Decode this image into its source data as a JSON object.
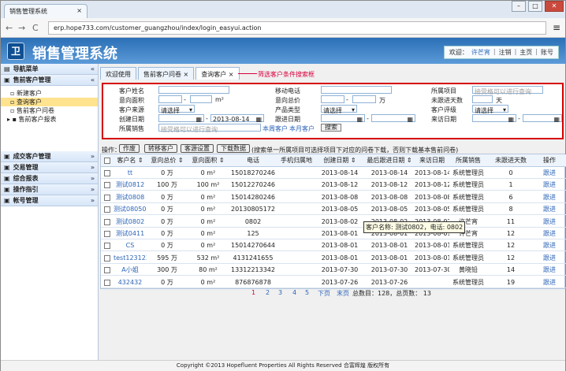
{
  "browser": {
    "tab_title": "销售管理系统",
    "tab_close": "×",
    "url": "erp.hope733.com/customer_guangzhou/index/login_easyui.action",
    "window_buttons": [
      "–",
      "□",
      "✕"
    ]
  },
  "header": {
    "title": "销售管理系统",
    "logo": "卫",
    "welcome": "欢迎：",
    "user_name": "许芒宵",
    "links": [
      "注销",
      "主页",
      "账号"
    ]
  },
  "sidebar": {
    "nav_title": "导航菜单",
    "collapse_icon": "«",
    "expand_icon": "»",
    "sections": [
      {
        "title": "售前客户管理",
        "expanded": true,
        "items": [
          "新建客户",
          "查询客户",
          "售前客户问卷",
          "售前客户报表"
        ]
      },
      {
        "title": "成交客户管理",
        "expanded": false,
        "items": []
      },
      {
        "title": "交易管理",
        "expanded": false,
        "items": []
      },
      {
        "title": "综合报表",
        "expanded": false,
        "items": []
      },
      {
        "title": "操作指引",
        "expanded": false,
        "items": []
      },
      {
        "title": "帐号管理",
        "expanded": false,
        "items": []
      }
    ]
  },
  "content_tabs": [
    "欢迎使用",
    "售前客户问卷",
    "查询客户"
  ],
  "annotation": "筛选客户条件搜索框",
  "search": {
    "labels": {
      "customer_name": "客户姓名",
      "mobile": "移动电话",
      "project": "所属项目",
      "area": "意向面积",
      "price": "意向总价",
      "followup_days": "未跟进天数",
      "source": "客户来源",
      "product_type": "产品类型",
      "rating": "客户评级",
      "created_date": "创建日期",
      "followup_date": "跟进日期",
      "visit_date": "来访日期",
      "sales": "所属销售"
    },
    "placeholder_query": "接受格可以进行查询",
    "unit_m2": "m²",
    "unit_wan": "万",
    "unit_day": "天",
    "range_sep": "-",
    "select_placeholder": "请选择",
    "created_date_end": "2013-08-14",
    "link_week": "本周客户",
    "link_month": "本月客户",
    "search_button": "搜索"
  },
  "toolbar": {
    "label": "操作：",
    "buttons": [
      "作废",
      "转移客户",
      "客源设置",
      "下载数据"
    ],
    "note": "(搜索单一所属项目可选择项目下对应的问卷下载，否则下载基本售前问卷)"
  },
  "table": {
    "columns": [
      "客户名",
      "意向总价",
      "意向面积",
      "电话",
      "手机归属地",
      "创建日期",
      "最后跟进日期",
      "来访日期",
      "所属销售",
      "未跟进天数",
      "操作"
    ],
    "rows": [
      {
        "name": "tt",
        "price": "0 万",
        "area": "0 m²",
        "phone": "15018270246",
        "region": "",
        "created": "2013-08-14",
        "last_followup": "2013-08-14",
        "visit": "2013-08-14",
        "sales": "系统管理员",
        "days": "0",
        "action": "跟进"
      },
      {
        "name": "测试0812",
        "price": "100 万",
        "area": "100 m²",
        "phone": "15012270246",
        "region": "",
        "created": "2013-08-12",
        "last_followup": "2013-08-12",
        "visit": "2013-08-12",
        "sales": "系统管理员",
        "days": "1",
        "action": "跟进"
      },
      {
        "name": "测试0808",
        "price": "0 万",
        "area": "0 m²",
        "phone": "15014280246",
        "region": "",
        "created": "2013-08-08",
        "last_followup": "2013-08-08",
        "visit": "2013-08-08",
        "sales": "系统管理员",
        "days": "6",
        "action": "跟进"
      },
      {
        "name": "测试080502",
        "price": "0 万",
        "area": "0 m²",
        "phone": "20130805172",
        "region": "",
        "created": "2013-08-05",
        "last_followup": "2013-08-05",
        "visit": "2013-08-05",
        "sales": "系统管理员",
        "days": "8",
        "action": "跟进"
      },
      {
        "name": "测试0802",
        "price": "0 万",
        "area": "0 m²",
        "phone": "0802",
        "region": "",
        "created": "2013-08-02",
        "last_followup": "2013-08-02",
        "visit": "2013-08-02",
        "sales": "许芒宵",
        "days": "11",
        "action": "跟进"
      },
      {
        "name": "测试0411",
        "price": "0 万",
        "area": "0 m²",
        "phone": "125",
        "region": "",
        "created": "2013-08-01",
        "last_followup": "2013-08-01",
        "visit": "2013-08-01",
        "sales": "许芒宵",
        "days": "12",
        "action": "跟进"
      },
      {
        "name": "CS",
        "price": "0 万",
        "area": "0 m²",
        "phone": "15014270644",
        "region": "",
        "created": "2013-08-01",
        "last_followup": "2013-08-01",
        "visit": "2013-08-01",
        "sales": "系统管理员",
        "days": "12",
        "action": "跟进"
      },
      {
        "name": "test123123",
        "price": "595 万",
        "area": "532 m²",
        "phone": "4131241655",
        "region": "",
        "created": "2013-08-01",
        "last_followup": "2013-08-01",
        "visit": "2013-08-01",
        "sales": "系统管理员",
        "days": "12",
        "action": "跟进"
      },
      {
        "name": "A小姐",
        "price": "300 万",
        "area": "80 m²",
        "phone": "13312213342",
        "region": "",
        "created": "2013-07-30",
        "last_followup": "2013-07-30",
        "visit": "2013-07-30",
        "sales": "黄晓铅",
        "days": "14",
        "action": "跟进"
      },
      {
        "name": "432432",
        "price": "0 万",
        "area": "0 m²",
        "phone": "876876878",
        "region": "",
        "created": "2013-07-26",
        "last_followup": "2013-07-26",
        "visit": "",
        "sales": "系统管理员",
        "days": "19",
        "action": "跟进"
      }
    ]
  },
  "tooltip": "客户名称: 测试0802，电话: 0802",
  "pager": {
    "pages": [
      "1",
      "2",
      "3",
      "4",
      "5"
    ],
    "current": "1",
    "next": "下页",
    "last": "末页",
    "total": "总数目：128，总页数： 13"
  },
  "footer": "Copyright ©2013 Hopefluent Properties All Rights Reserved 合富辉煌 版权所有"
}
